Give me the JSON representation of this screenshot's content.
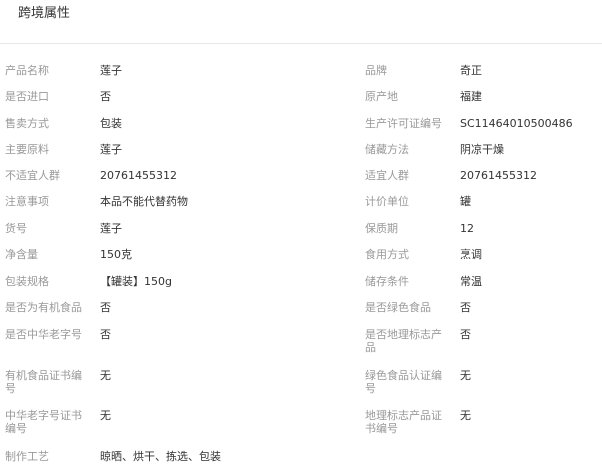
{
  "section": {
    "title": "跨境属性"
  },
  "rows": [
    {
      "left": {
        "label": "产品名称",
        "value": "莲子"
      },
      "right": {
        "label": "品牌",
        "value": "奇正"
      }
    },
    {
      "left": {
        "label": "是否进口",
        "value": "否"
      },
      "right": {
        "label": "原产地",
        "value": "福建"
      }
    },
    {
      "left": {
        "label": "售卖方式",
        "value": "包装"
      },
      "right": {
        "label": "生产许可证编号",
        "value": "SC11464010500486"
      }
    },
    {
      "left": {
        "label": "主要原料",
        "value": "莲子"
      },
      "right": {
        "label": "储藏方法",
        "value": "阴凉干燥"
      }
    },
    {
      "left": {
        "label": "不适宜人群",
        "value": "20761455312"
      },
      "right": {
        "label": "适宜人群",
        "value": "20761455312"
      }
    },
    {
      "left": {
        "label": "注意事项",
        "value": "本品不能代替药物"
      },
      "right": {
        "label": "计价单位",
        "value": "罐"
      }
    },
    {
      "left": {
        "label": "货号",
        "value": "莲子"
      },
      "right": {
        "label": "保质期",
        "value": "12"
      }
    },
    {
      "left": {
        "label": "净含量",
        "value": "150克"
      },
      "right": {
        "label": "食用方式",
        "value": "烹调"
      }
    },
    {
      "left": {
        "label": "包装规格",
        "value": "【罐装】150g"
      },
      "right": {
        "label": "储存条件",
        "value": "常温"
      }
    },
    {
      "left": {
        "label": "是否为有机食品",
        "value": "否"
      },
      "right": {
        "label": "是否绿色食品",
        "value": "否"
      }
    },
    {
      "left": {
        "label": "是否中华老字号",
        "value": "否"
      },
      "right": {
        "label": "是否地理标志产品",
        "value": "否"
      }
    },
    {
      "left": {
        "label": "有机食品证书编号",
        "value": "无"
      },
      "right": {
        "label": "绿色食品认证编号",
        "value": "无"
      }
    },
    {
      "left": {
        "label": "中华老字号证书编号",
        "value": "无"
      },
      "right": {
        "label": "地理标志产品证书编号",
        "value": "无"
      }
    },
    {
      "left": {
        "label": "制作工艺",
        "value": "晾晒、烘干、拣选、包装"
      }
    }
  ]
}
